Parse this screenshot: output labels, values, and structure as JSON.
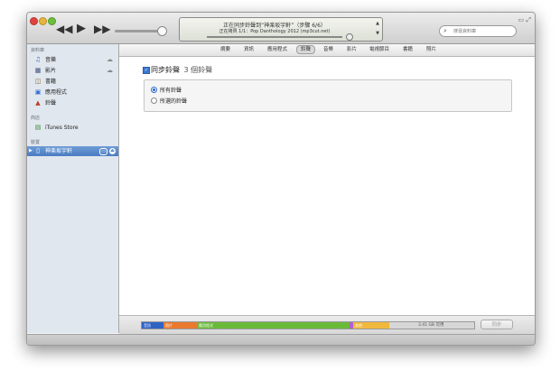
{
  "titlebar": {
    "lcd_line1": "正在同步鈴聲到“神楽坂宇軒”（步驟 6/6）",
    "lcd_line2": "正在拷貝 1/1：Pop Danthology 2012 (mp3cut.net)",
    "search_placeholder": "搜尋資料庫"
  },
  "sidebar": {
    "sections": [
      {
        "heading": "資料庫",
        "items": [
          {
            "label": "音樂",
            "icon": "music-note-icon",
            "cloud": true
          },
          {
            "label": "影片",
            "icon": "film-icon",
            "cloud": true
          },
          {
            "label": "書籍",
            "icon": "book-icon",
            "cloud": false
          },
          {
            "label": "應用程式",
            "icon": "app-icon",
            "cloud": false
          },
          {
            "label": "鈴聲",
            "icon": "bell-icon",
            "cloud": false
          }
        ]
      },
      {
        "heading": "商店",
        "items": [
          {
            "label": "iTunes Store",
            "icon": "store-icon"
          }
        ]
      },
      {
        "heading": "裝置",
        "items": [
          {
            "label": "神楽坂宇軒",
            "icon": "iphone-icon",
            "selected": true
          }
        ]
      }
    ]
  },
  "tabs": [
    {
      "label": "摘要"
    },
    {
      "label": "資訊"
    },
    {
      "label": "應用程式"
    },
    {
      "label": "鈴聲",
      "active": true
    },
    {
      "label": "音樂"
    },
    {
      "label": "影片"
    },
    {
      "label": "電視節目"
    },
    {
      "label": "書籍"
    },
    {
      "label": "照片"
    }
  ],
  "ringtones": {
    "sync_label": "同步鈴聲",
    "sync_count": "3 個鈴聲",
    "sync_checked": true,
    "options": [
      {
        "label": "所有鈴聲",
        "selected": true
      },
      {
        "label": "所選的鈴聲",
        "selected": false
      }
    ]
  },
  "capacity": {
    "segments": [
      {
        "label": "音訊",
        "color": "#2f63c4",
        "fraction": 0.066
      },
      {
        "label": "照片",
        "color": "#e97a30",
        "fraction": 0.1
      },
      {
        "label": "應用程式",
        "color": "#6aba3a",
        "fraction": 0.46
      },
      {
        "label": "",
        "color": "#b25ed1",
        "fraction": 0.01
      },
      {
        "label": "其他",
        "color": "#f0b83d",
        "fraction": 0.11
      }
    ],
    "free_label": "3.41 GB 可用",
    "sync_button": "同步"
  },
  "colors": {
    "sidebar_bg": "#e1e7ee",
    "selection": "#4a7cc2",
    "accent_radio": "#2d6bd1"
  }
}
